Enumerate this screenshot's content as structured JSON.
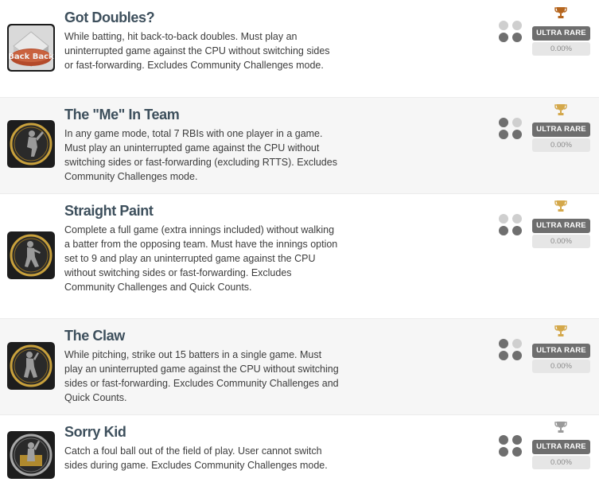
{
  "achievements": [
    {
      "title": "Got Doubles?",
      "description": "While batting, hit back-to-back doubles. Must play an uninterrupted game against the CPU without switching sides or fast-forwarding. Excludes Community Challenges mode.",
      "thumbnail_text": "Back Back",
      "rarity": "ULTRA RARE",
      "percent": "0.00%",
      "trophy_color": "#b5651d",
      "trophy_icon": "trophy-icon",
      "thumbnail_icon": "back-to-back-tile-icon",
      "dots_filled": [
        false,
        false,
        true,
        true
      ]
    },
    {
      "title": "The \"Me\" In Team",
      "description": "In any game mode, total 7 RBIs with one player in a game. Must play an uninterrupted game against the CPU without switching sides or fast-forwarding (excluding RTTS). Excludes Community Challenges mode.",
      "rarity": "ULTRA RARE",
      "percent": "0.00%",
      "trophy_color": "#d4a84b",
      "trophy_icon": "trophy-icon",
      "thumbnail_icon": "batter-medallion-icon",
      "dots_filled": [
        true,
        false,
        true,
        true
      ]
    },
    {
      "title": "Straight Paint",
      "description": "Complete a full game (extra innings included) without walking a batter from the opposing team. Must have the innings option set to 9 and play an uninterrupted game against the CPU without switching sides or fast-forwarding. Excludes Community Challenges and Quick Counts.",
      "rarity": "ULTRA RARE",
      "percent": "0.00%",
      "trophy_color": "#d4a84b",
      "trophy_icon": "trophy-icon",
      "thumbnail_icon": "pitcher-medallion-icon",
      "dots_filled": [
        false,
        false,
        true,
        true
      ]
    },
    {
      "title": "The Claw",
      "description": "While pitching, strike out 15 batters in a single game. Must play an uninterrupted game against the CPU without switching sides or fast-forwarding. Excludes Community Challenges and Quick Counts.",
      "rarity": "ULTRA RARE",
      "percent": "0.00%",
      "trophy_color": "#d4a84b",
      "trophy_icon": "trophy-icon",
      "thumbnail_icon": "pitcher-claw-medallion-icon",
      "dots_filled": [
        true,
        false,
        true,
        true
      ]
    },
    {
      "title": "Sorry Kid",
      "description": "Catch a foul ball out of the field of play. User cannot switch sides during game. Excludes Community Challenges mode.",
      "rarity": "ULTRA RARE",
      "percent": "0.00%",
      "trophy_color": "#9a9a9a",
      "trophy_icon": "trophy-icon",
      "thumbnail_icon": "fan-catch-medallion-icon",
      "dots_filled": [
        true,
        true,
        true,
        true
      ]
    }
  ],
  "colors": {
    "badge_bg": "#6e6e6e",
    "dot_filled": "#6f6f6f",
    "dot_empty": "#cfcfcf",
    "title": "#3d4f5c"
  }
}
